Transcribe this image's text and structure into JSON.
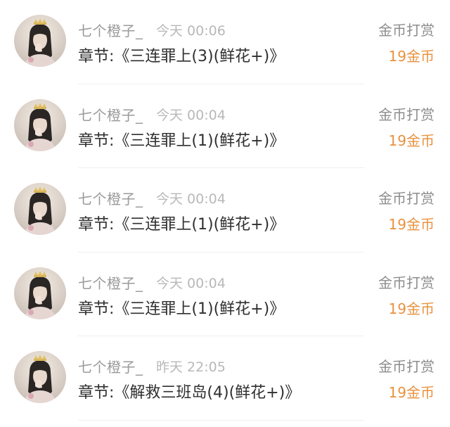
{
  "items": [
    {
      "name": "七个橙子_",
      "time": "今天 00:06",
      "chapter": "章节:《三连罪上(3)(鲜花+)》",
      "action": "金币打赏",
      "amount": "19金币"
    },
    {
      "name": "七个橙子_",
      "time": "今天 00:04",
      "chapter": "章节:《三连罪上(1)(鲜花+)》",
      "action": "金币打赏",
      "amount": "19金币"
    },
    {
      "name": "七个橙子_",
      "time": "今天 00:04",
      "chapter": "章节:《三连罪上(1)(鲜花+)》",
      "action": "金币打赏",
      "amount": "19金币"
    },
    {
      "name": "七个橙子_",
      "time": "今天 00:04",
      "chapter": "章节:《三连罪上(1)(鲜花+)》",
      "action": "金币打赏",
      "amount": "19金币"
    },
    {
      "name": "七个橙子_",
      "time": "昨天 22:05",
      "chapter": "章节:《解救三班岛(4)(鲜花+)》",
      "action": "金币打赏",
      "amount": "19金币"
    }
  ],
  "colors": {
    "name": "#9a9a9a",
    "time": "#b8b8b8",
    "chapter": "#2f2f2f",
    "action": "#8c8c8c",
    "amount": "#e89240",
    "divider": "#efefef"
  }
}
